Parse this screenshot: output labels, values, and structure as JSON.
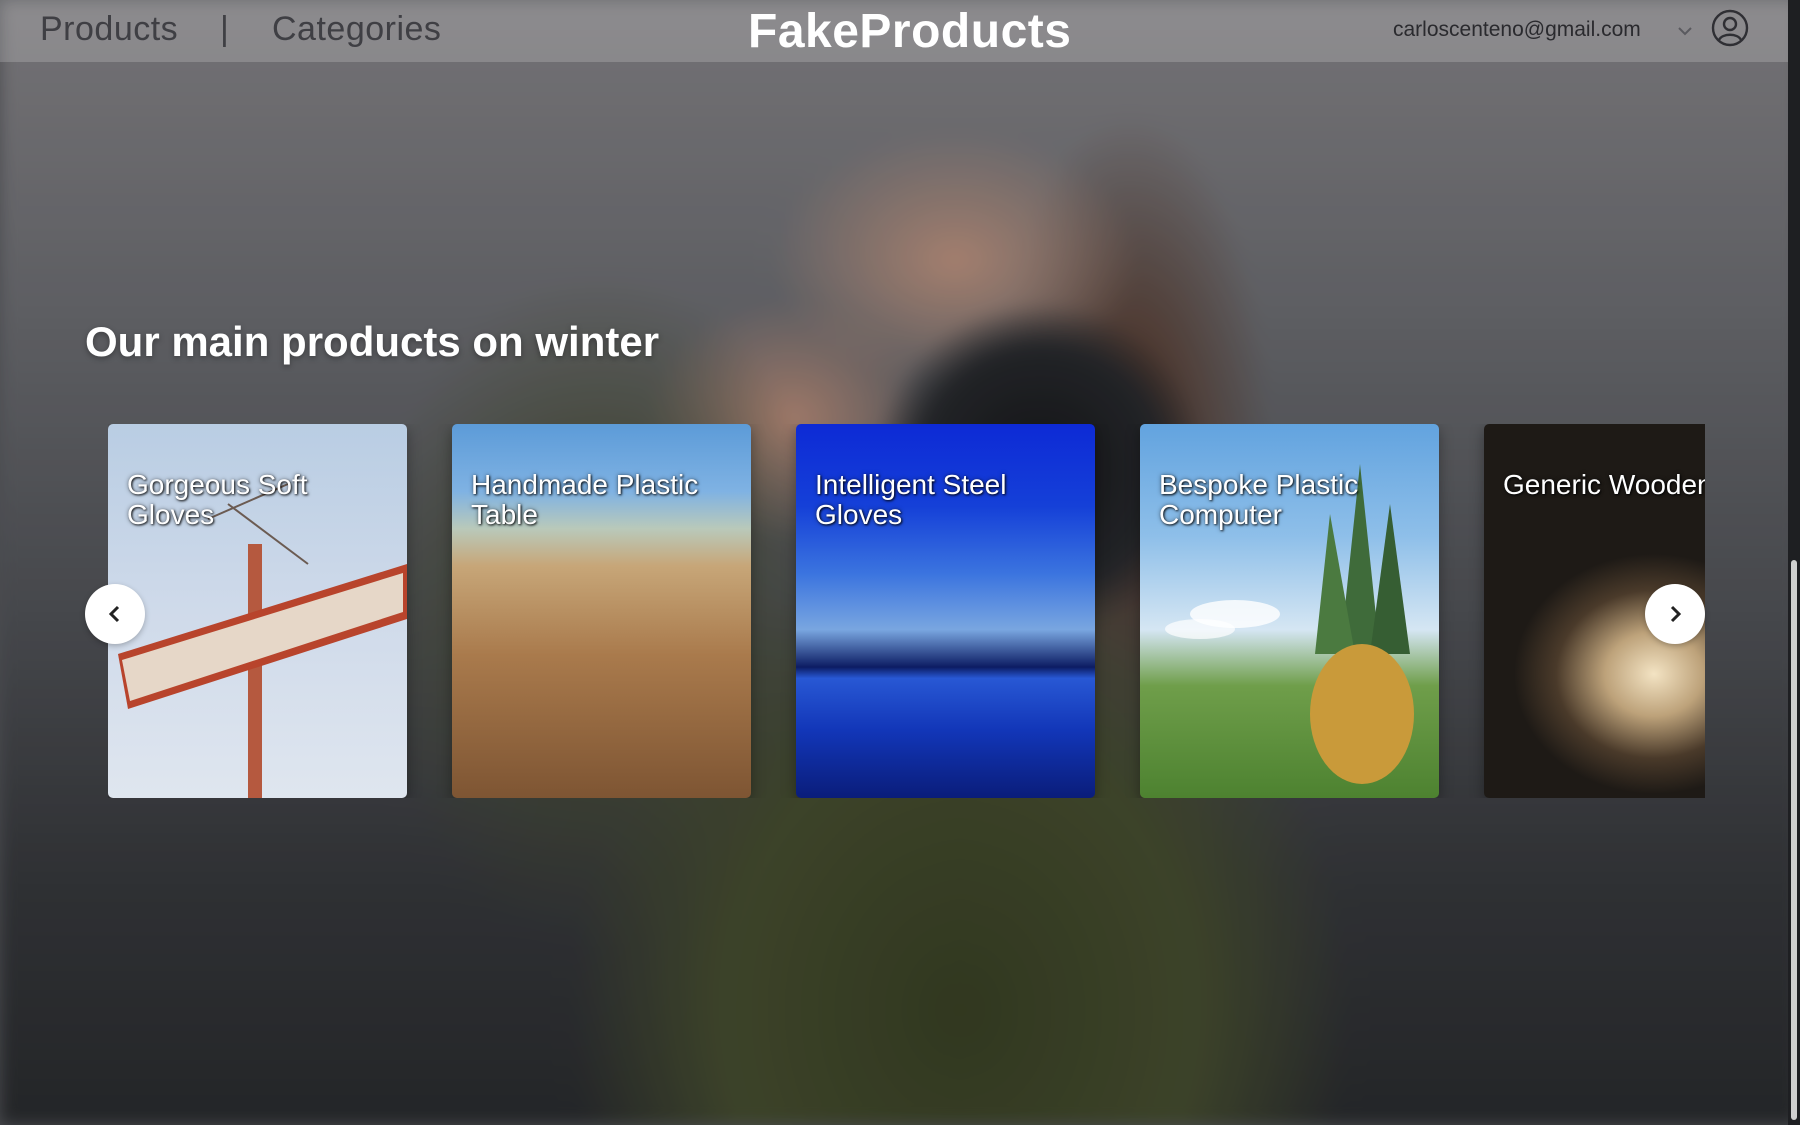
{
  "header": {
    "nav": {
      "products_label": "Products",
      "separator": "|",
      "categories_label": "Categories"
    },
    "brand": "FakeProducts",
    "user": {
      "email": "carloscenteno@gmail.com",
      "dropdown_icon": "chevron-down-icon",
      "avatar_icon": "user-circle-icon"
    }
  },
  "main": {
    "section_title": "Our main products on winter",
    "carousel": {
      "prev_icon": "chevron-left-icon",
      "next_icon": "chevron-right-icon",
      "cards": [
        {
          "title": "Gorgeous Soft Gloves"
        },
        {
          "title": "Handmade Plastic Table"
        },
        {
          "title": "Intelligent Steel Gloves"
        },
        {
          "title": "Bespoke Plastic Computer"
        },
        {
          "title": "Generic Wooden Car"
        }
      ]
    }
  },
  "colors": {
    "brand_text": "#ffffff",
    "nav_text": "#3f3f44",
    "arrow_bg": "#ffffff"
  }
}
